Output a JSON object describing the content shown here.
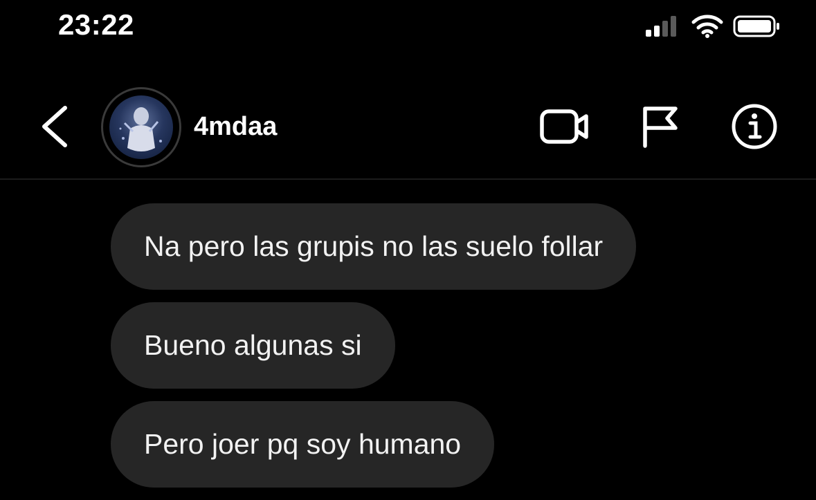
{
  "status_bar": {
    "time": "23:22"
  },
  "header": {
    "username": "4mdaa",
    "actions": [
      "video-call-icon",
      "flag-icon",
      "info-icon"
    ]
  },
  "messages": [
    {
      "text": "Na pero las grupis no las suelo follar"
    },
    {
      "text": "Bueno algunas si"
    },
    {
      "text": "Pero joer pq soy humano"
    }
  ],
  "colors": {
    "background": "#000000",
    "bubble": "#262626",
    "text": "#ffffff"
  }
}
